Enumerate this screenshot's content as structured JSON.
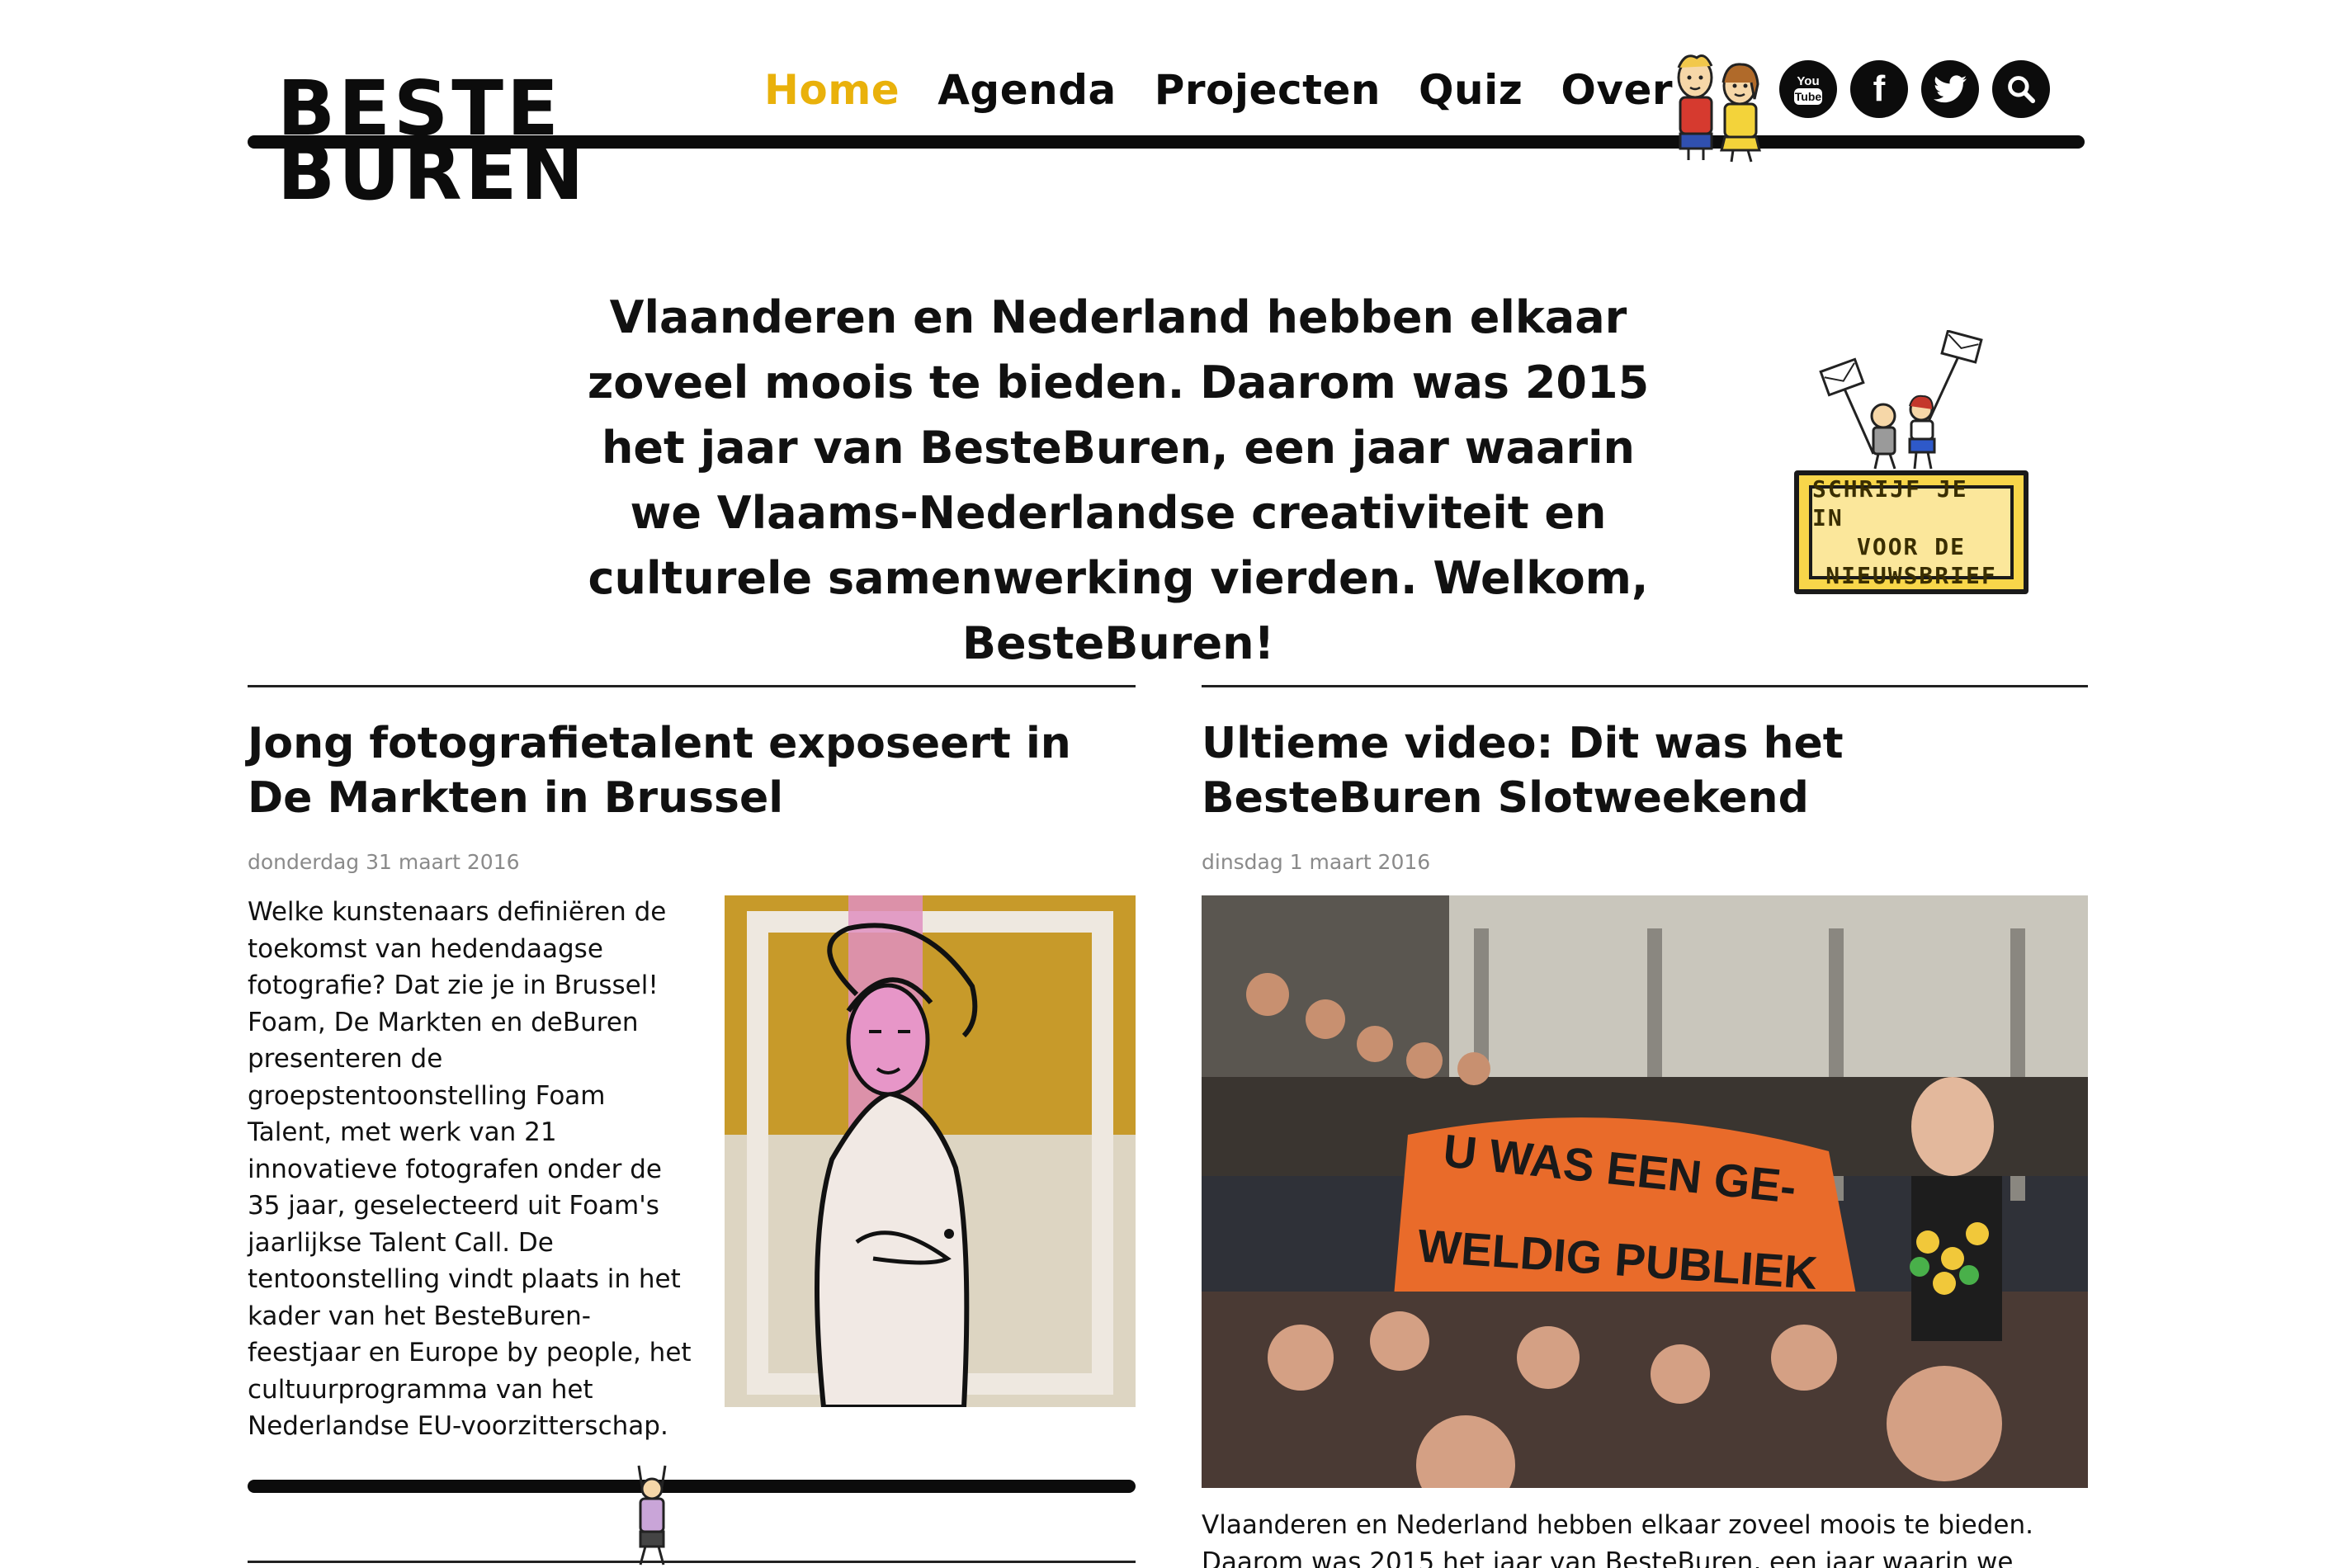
{
  "header": {
    "logo_line1": "BESTE",
    "logo_line2": "BUREN",
    "nav": [
      {
        "label": "Home",
        "active": true
      },
      {
        "label": "Agenda",
        "active": false
      },
      {
        "label": "Projecten",
        "active": false
      },
      {
        "label": "Quiz",
        "active": false
      },
      {
        "label": "Over",
        "active": false
      }
    ],
    "social": [
      {
        "icon": "youtube-icon",
        "label": "You Tube"
      },
      {
        "icon": "facebook-icon",
        "label": "f"
      },
      {
        "icon": "twitter-icon",
        "label": ""
      },
      {
        "icon": "search-icon",
        "label": ""
      }
    ],
    "youtube_text_1": "You",
    "youtube_text_2": "Tube",
    "facebook_glyph": "f"
  },
  "intro": {
    "text": "Vlaanderen en Nederland hebben elkaar zoveel moois te bieden. Daarom was 2015 het jaar van BesteBuren, een jaar waarin we Vlaams-Nederlandse creativiteit en culturele samenwerking vierden. Welkom, BesteBuren!"
  },
  "newsletter": {
    "line1": "SCHRIJF JE IN",
    "line2": "VOOR DE",
    "line3": "NIEUWSBRIEF"
  },
  "articles": [
    {
      "title": "Jong fotografietalent exposeert in De Markten in Brussel",
      "date": "donderdag 31 maart 2016",
      "body": "Welke kunstenaars definiëren de toekomst van hedendaagse fotografie? Dat zie je in Brussel! Foam, De Markten en deBuren presenteren de groepstentoonstelling Foam Talent, met werk van 21 innovatieve fotografen onder de 35 jaar, geselecteerd uit Foam's jaarlijkse Talent Call. De tentoonstelling vindt plaats in het kader van het BesteBuren-feestjaar en Europe by people, het cultuurprogramma van het Nederlandse EU-voorzitterschap."
    },
    {
      "title": "Ultieme video: Dit was het BesteBuren Slotweekend",
      "date": "dinsdag 1 maart 2016",
      "banner_line1": "U WAS EEN GE-",
      "banner_line2": "WELDIG PUBLIEK",
      "body": "Vlaanderen en Nederland hebben elkaar zoveel moois te bieden. Daarom was 2015 het jaar van BesteBuren, een jaar waarin we Vlaams-"
    }
  ],
  "colors": {
    "accent": "#e9b10b",
    "text": "#111111",
    "date": "#8a8a8a"
  }
}
